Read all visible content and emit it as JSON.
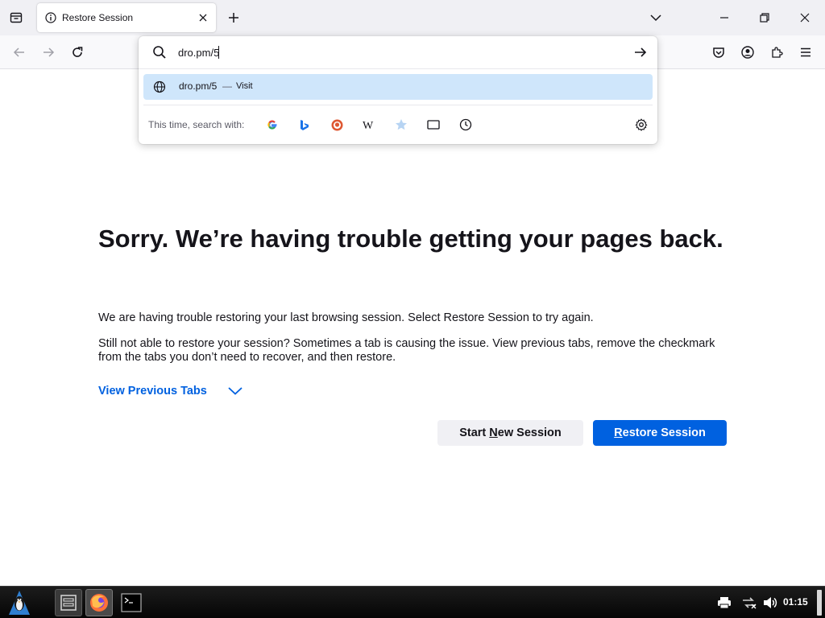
{
  "browser": {
    "tab": {
      "title": "Restore Session",
      "active": true
    },
    "urlbar": {
      "value": "dro.pm/5",
      "suggestion": {
        "title": "dro.pm/5",
        "separator": "—",
        "action": "Visit"
      },
      "oneoff_label": "This time, search with:",
      "engines": [
        "google-icon",
        "bing-icon",
        "duckduckgo-icon",
        "wikipedia-icon",
        "bookmarks-star-icon",
        "tabs-icon",
        "history-clock-icon"
      ]
    }
  },
  "page": {
    "title": "Sorry. We’re having trouble getting your pages back.",
    "paragraph1": "We are having trouble restoring your last browsing session. Select Restore Session to try again.",
    "paragraph2": "Still not able to restore your session? Sometimes a tab is causing the issue. View previous tabs, remove the checkmark from the tabs you don’t need to recover, and then restore.",
    "view_previous_tabs": "View Previous Tabs",
    "start_new_session": {
      "pre": "Start ",
      "accesskey": "N",
      "post": "ew Session"
    },
    "restore_session": {
      "pre": "",
      "accesskey": "R",
      "post": "estore Session"
    }
  },
  "taskbar": {
    "clock": "01:15",
    "apps": [
      "file-manager-icon",
      "firefox-icon",
      "terminal-icon"
    ]
  },
  "colors": {
    "accent": "#0061e0",
    "suggestion_highlight": "#cfe6fb",
    "secondary_button": "#f0f0f4"
  }
}
